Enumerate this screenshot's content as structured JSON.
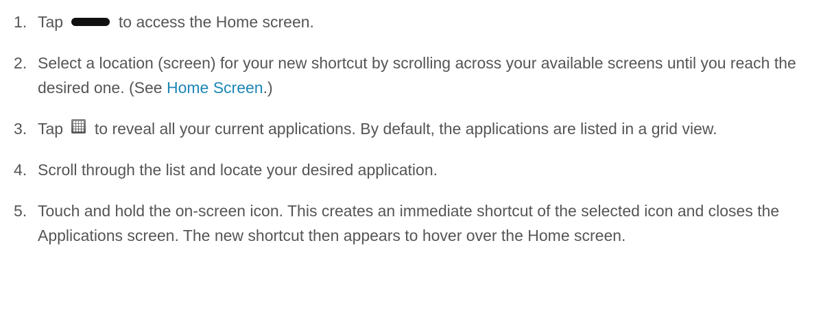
{
  "steps": [
    {
      "num": "1.",
      "before": "Tap",
      "icon": "home-key-icon",
      "after": "to access the Home screen."
    },
    {
      "num": "2.",
      "before": "Select a location (screen) for your new shortcut by scrolling across your available screens until you reach the desired one. (See ",
      "link": "Home Screen",
      "after": ".)"
    },
    {
      "num": "3.",
      "before": "Tap",
      "icon": "applications-grid-icon",
      "after": "to reveal all your current applications. By default, the applications are listed in a grid view."
    },
    {
      "num": "4.",
      "text": "Scroll through the list and locate your desired application."
    },
    {
      "num": "5.",
      "text": "Touch and hold the on-screen icon. This creates an immediate shortcut of the selected icon and closes the Applications screen. The new shortcut then appears to hover over the Home screen."
    }
  ],
  "colors": {
    "text": "#555555",
    "link": "#1d86b6",
    "icon": "#111111"
  }
}
